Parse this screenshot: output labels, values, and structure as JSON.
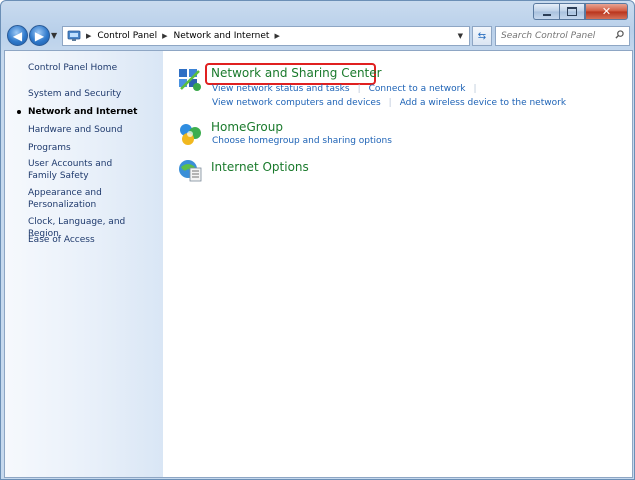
{
  "address_bar": {
    "crumbs": [
      "Control Panel",
      "Network and Internet"
    ]
  },
  "search": {
    "placeholder": "Search Control Panel"
  },
  "sidebar": {
    "items": [
      {
        "label": "Control Panel Home"
      },
      {
        "label": "System and Security"
      },
      {
        "label": "Network and Internet",
        "current": true
      },
      {
        "label": "Hardware and Sound"
      },
      {
        "label": "Programs"
      },
      {
        "label": "User Accounts and Family Safety"
      },
      {
        "label": "Appearance and Personalization"
      },
      {
        "label": "Clock, Language, and Region"
      },
      {
        "label": "Ease of Access"
      }
    ]
  },
  "categories": [
    {
      "title": "Network and Sharing Center",
      "icon": "network-icon",
      "links": [
        "View network status and tasks",
        "Connect to a network",
        "View network computers and devices",
        "Add a wireless device to the network"
      ],
      "highlighted": true
    },
    {
      "title": "HomeGroup",
      "icon": "homegroup-icon",
      "links": [
        "Choose homegroup and sharing options"
      ]
    },
    {
      "title": "Internet Options",
      "icon": "internet-options-icon",
      "links": []
    }
  ],
  "colors": {
    "link": "#1e63b6",
    "category_title": "#1a7a2c",
    "highlight": "#e02020"
  }
}
